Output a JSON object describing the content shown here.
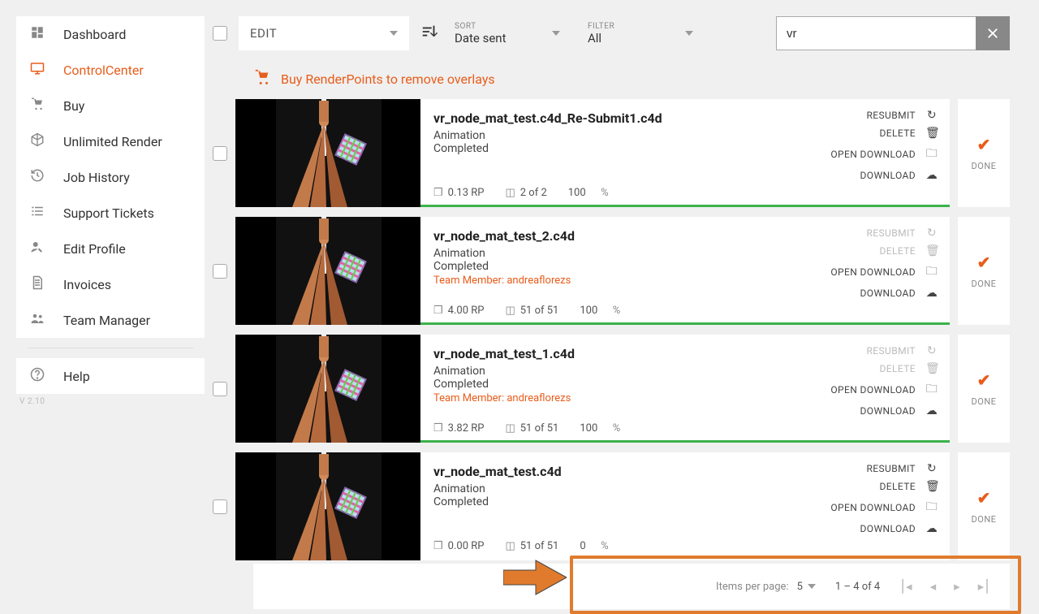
{
  "sidebar": {
    "items": [
      {
        "label": "Dashboard",
        "icon": "grid"
      },
      {
        "label": "ControlCenter",
        "icon": "monitor",
        "active": true
      },
      {
        "label": "Buy",
        "icon": "cart"
      },
      {
        "label": "Unlimited Render",
        "icon": "cube"
      },
      {
        "label": "Job History",
        "icon": "history"
      },
      {
        "label": "Support Tickets",
        "icon": "list"
      },
      {
        "label": "Edit Profile",
        "icon": "user-edit"
      },
      {
        "label": "Invoices",
        "icon": "file"
      },
      {
        "label": "Team Manager",
        "icon": "team"
      }
    ],
    "help": {
      "label": "Help",
      "icon": "help"
    },
    "version": "V 2.10"
  },
  "topbar": {
    "edit_label": "EDIT",
    "sort_label": "SORT",
    "sort_value": "Date sent",
    "filter_label": "FILTER",
    "filter_value": "All",
    "search_value": "vr"
  },
  "banner": {
    "text": "Buy RenderPoints to remove overlays"
  },
  "actions": {
    "resubmit": "RESUBMIT",
    "delete": "DELETE",
    "open_download": "OPEN DOWNLOAD",
    "download": "DOWNLOAD"
  },
  "status": {
    "done": "DONE"
  },
  "jobs": [
    {
      "title": "vr_node_mat_test.c4d_Re-Submit1.c4d",
      "type": "Animation",
      "state": "Completed",
      "rp": "0.13 RP",
      "frames": "2 of 2",
      "pct": "100",
      "team_member": null,
      "resubmit_disabled": false,
      "delete_disabled": false,
      "progress": true
    },
    {
      "title": "vr_node_mat_test_2.c4d",
      "type": "Animation",
      "state": "Completed",
      "rp": "4.00 RP",
      "frames": "51 of 51",
      "pct": "100",
      "team_member": "Team Member: andreaflorezs",
      "resubmit_disabled": true,
      "delete_disabled": true,
      "progress": true
    },
    {
      "title": "vr_node_mat_test_1.c4d",
      "type": "Animation",
      "state": "Completed",
      "rp": "3.82 RP",
      "frames": "51 of 51",
      "pct": "100",
      "team_member": "Team Member: andreaflorezs",
      "resubmit_disabled": true,
      "delete_disabled": true,
      "progress": true
    },
    {
      "title": "vr_node_mat_test.c4d",
      "type": "Animation",
      "state": "Completed",
      "rp": "0.00 RP",
      "frames": "51 of 51",
      "pct": "0",
      "team_member": null,
      "resubmit_disabled": false,
      "delete_disabled": false,
      "progress": false
    }
  ],
  "pagination": {
    "items_per_page_label": "Items per page:",
    "items_per_page_value": "5",
    "range": "1 – 4 of 4"
  }
}
